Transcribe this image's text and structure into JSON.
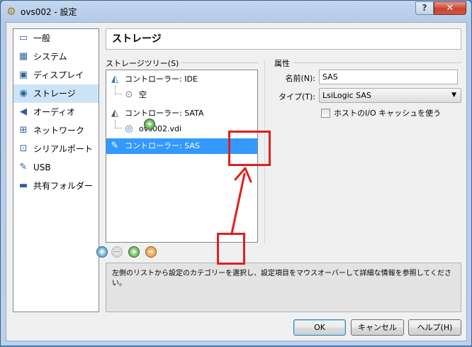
{
  "window": {
    "title": "ovs002 - 設定",
    "help_label": "?",
    "close_label": "✕"
  },
  "sidebar": {
    "items": [
      {
        "label": "一般",
        "icon": "monitor-icon",
        "glyph": "▭"
      },
      {
        "label": "システム",
        "icon": "chip-icon",
        "glyph": "▦"
      },
      {
        "label": "ディスプレイ",
        "icon": "display-icon",
        "glyph": "▣"
      },
      {
        "label": "ストレージ",
        "icon": "disk-icon",
        "glyph": "◉"
      },
      {
        "label": "オーディオ",
        "icon": "speaker-icon",
        "glyph": "◀"
      },
      {
        "label": "ネットワーク",
        "icon": "network-icon",
        "glyph": "⊞"
      },
      {
        "label": "シリアルポート",
        "icon": "serial-port-icon",
        "glyph": "⊡"
      },
      {
        "label": "USB",
        "icon": "usb-icon",
        "glyph": "✎"
      },
      {
        "label": "共有フォルダー",
        "icon": "folder-icon",
        "glyph": "▬"
      }
    ],
    "selected_index": 3
  },
  "page": {
    "title": "ストレージ"
  },
  "tree_panel": {
    "label": "ストレージツリー(S)",
    "controllers": {
      "ide": {
        "label": "コントローラー: IDE",
        "child": "空"
      },
      "sata": {
        "label": "コントローラー: SATA",
        "child": "ovs002.vdi"
      },
      "sas": {
        "label": "コントローラー: SAS"
      }
    },
    "add_attachment_symbol": "+",
    "toolbar": {
      "add_controller": "+",
      "remove_controller": "−",
      "add_attachment": "+",
      "remove_attachment": "−"
    }
  },
  "attributes": {
    "label": "属性",
    "name_label": "名前(N):",
    "name_value": "SAS",
    "type_label": "タイプ(T):",
    "type_value": "LsiLogic SAS",
    "host_io_cache_label": "ホストのI/O キャッシュを使う",
    "host_io_cache_checked": false
  },
  "info_text": "左側のリストから設定のカテゴリーを選択し、設定項目をマウスオーバーして詳細な情報を参照してください。",
  "buttons": {
    "ok": "OK",
    "cancel": "キャンセル",
    "help": "ヘルプ(H)"
  },
  "colors": {
    "annotation": "#e01f1f",
    "selection": "#3399ff"
  }
}
